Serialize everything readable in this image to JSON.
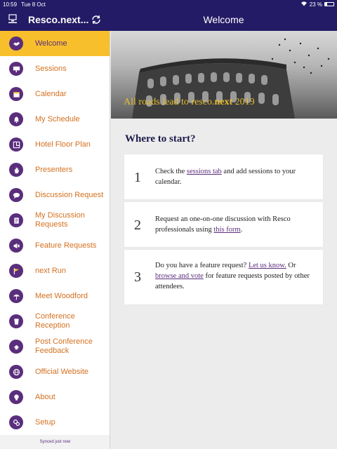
{
  "status": {
    "time": "10:59",
    "date": "Tue 8 Oct",
    "battery": "23 %"
  },
  "header": {
    "app_title": "Resco.next...",
    "page_title": "Welcome"
  },
  "sidebar": {
    "items": [
      {
        "label": "Welcome",
        "icon": "handshake-icon",
        "active": true
      },
      {
        "label": "Sessions",
        "icon": "presentation-icon"
      },
      {
        "label": "Calendar",
        "icon": "calendar-icon"
      },
      {
        "label": "My Schedule",
        "icon": "bell-icon"
      },
      {
        "label": "Hotel Floor Plan",
        "icon": "floor-plan-icon"
      },
      {
        "label": "Presenters",
        "icon": "hand-icon"
      },
      {
        "label": "Discussion Request",
        "icon": "chat-icon"
      },
      {
        "label": "My Discussion Requests",
        "icon": "document-icon"
      },
      {
        "label": "Feature Requests",
        "icon": "megaphone-icon"
      },
      {
        "label": "next Run",
        "icon": "flag-icon"
      },
      {
        "label": "Meet Woodford",
        "icon": "umbrella-icon"
      },
      {
        "label": "Conference Reception",
        "icon": "glass-icon"
      },
      {
        "label": "Post Conference Feedback",
        "icon": "feedback-icon"
      },
      {
        "label": "Official Website",
        "icon": "globe-icon"
      },
      {
        "label": "About",
        "icon": "bulb-icon"
      },
      {
        "label": "Setup",
        "icon": "gears-icon"
      }
    ],
    "synced": "Synced just now"
  },
  "banner": {
    "tagline_pre": "All roads lead to resco.",
    "tagline_bold": "next",
    "tagline_post": " 2019"
  },
  "main": {
    "heading": "Where to start?",
    "steps": [
      {
        "num": "1",
        "pre": "Check the ",
        "link": "sessions tab",
        "post": " and add sessions to your calendar."
      },
      {
        "num": "2",
        "pre": "Request an one-on-one discussion with Resco professionals using ",
        "link": "this form",
        "post": "."
      },
      {
        "num": "3",
        "pre": "Do you have a feature request? ",
        "link": "Let us know.",
        "mid": " Or ",
        "link2": "browse and vote",
        "post": " for feature requests posted by other attendees."
      }
    ]
  }
}
